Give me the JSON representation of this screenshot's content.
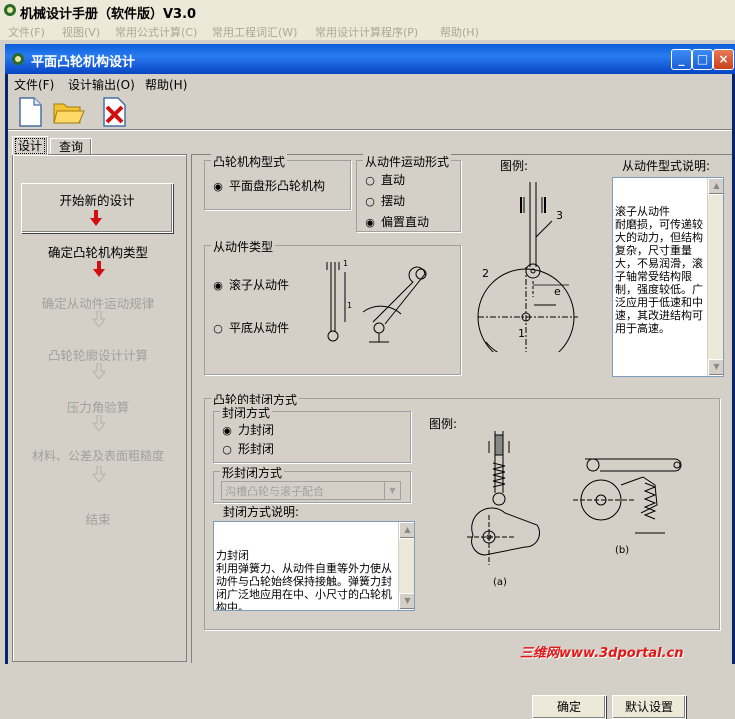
{
  "outer": {
    "title": "机械设计手册（软件版）V3.0",
    "menu": [
      "文件(F)",
      "视图(V)",
      "常用公式计算(C)",
      "常用工程词汇(W)",
      "常用设计计算程序(P)",
      "帮助(H)"
    ]
  },
  "window": {
    "title": "平面凸轮机构设计",
    "menu": [
      "文件(F)",
      "设计输出(O)",
      "帮助(H)"
    ]
  },
  "tabs": [
    "设计",
    "查询"
  ],
  "steps": [
    {
      "label": "开始新的设计",
      "active": true
    },
    {
      "label": "确定凸轮机构类型",
      "active": true
    },
    {
      "label": "确定从动件运动规律",
      "active": false
    },
    {
      "label": "凸轮轮廓设计计算",
      "active": false
    },
    {
      "label": "压力角验算",
      "active": false
    },
    {
      "label": "材料、公差及表面粗糙度",
      "active": false
    },
    {
      "label": "结束",
      "active": false
    }
  ],
  "cam_form": {
    "title": "凸轮机构型式",
    "option": "平面盘形凸轮机构"
  },
  "follower_motion": {
    "title": "从动件运动形式",
    "options": [
      "直动",
      "摆动",
      "偏置直动"
    ],
    "selected": 2
  },
  "follower_type": {
    "title": "从动件类型",
    "options": [
      "滚子从动件",
      "平底从动件"
    ],
    "selected": 0
  },
  "legend1": {
    "title": "图例:",
    "labels": [
      "3",
      "2",
      "e",
      "1"
    ]
  },
  "desc": {
    "title": "从动件型式说明:",
    "text": "滚子从动件\n耐磨损，可传递较大的动力，但结构复杂，尺寸重量大，不易润滑，滚子轴常受结构限制，强度较低。广泛应用于低速和中速，其改进结构可用于高速。"
  },
  "closure": {
    "title": "凸轮的封闭方式",
    "mode_title": "封闭方式",
    "options": [
      "力封闭",
      "形封闭"
    ],
    "selected": 0,
    "shape_title": "形封闭方式",
    "shape_value": "沟槽凸轮与滚子配合",
    "desc_title": "封闭方式说明:",
    "desc_text": "力封闭\n利用弹簧力、从动件自重等外力使从动件与凸轮始终保持接触。弹簧力封闭广泛地应用在中、小尺寸的凸轮机构中。"
  },
  "legend2": {
    "title": "图例:",
    "labels": [
      "(a)",
      "(b)"
    ]
  },
  "buttons": {
    "ok": "确定",
    "default": "默认设置"
  },
  "watermark": "三维网www.3dportal.cn"
}
